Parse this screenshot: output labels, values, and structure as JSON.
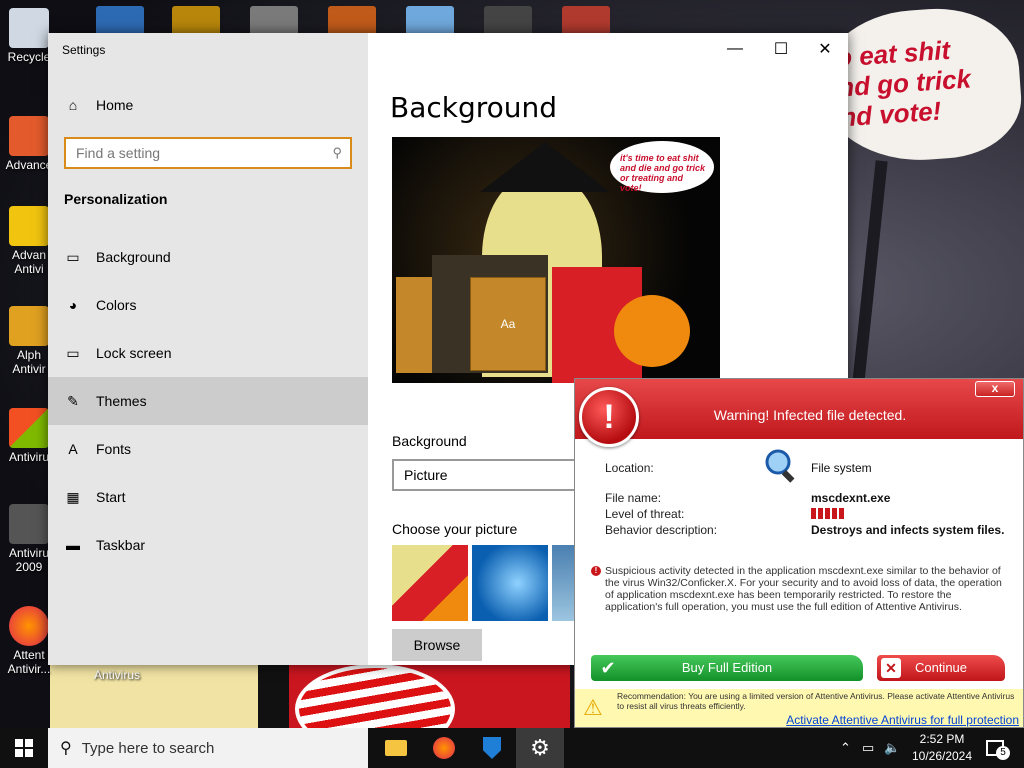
{
  "desktop": {
    "bubble_text": "o eat shit\nnd go trick\nnd vote!",
    "icons": [
      {
        "label": "Recycle"
      },
      {
        "label": "Advance"
      },
      {
        "label": "Advan\nAntivi"
      },
      {
        "label": "Alph\nAntivir"
      },
      {
        "label": "Antiviru"
      },
      {
        "label": "Antiviru\n2009"
      },
      {
        "label": "Attent\nAntivir..."
      },
      {
        "label": "Antivirus"
      }
    ]
  },
  "settings": {
    "window_title": "Settings",
    "home_label": "Home",
    "search_placeholder": "Find a setting",
    "section": "Personalization",
    "nav": [
      {
        "label": "Background",
        "icon": "picture-icon"
      },
      {
        "label": "Colors",
        "icon": "palette-icon"
      },
      {
        "label": "Lock screen",
        "icon": "lock-screen-icon"
      },
      {
        "label": "Themes",
        "icon": "themes-icon"
      },
      {
        "label": "Fonts",
        "icon": "fonts-icon"
      },
      {
        "label": "Start",
        "icon": "start-icon"
      },
      {
        "label": "Taskbar",
        "icon": "taskbar-icon"
      }
    ],
    "selected_nav": "Themes",
    "page_title": "Background",
    "preview_bubble": "it's time to eat shit and die and go trick or treating and vote!",
    "preview_tile": "Aa",
    "background_label": "Background",
    "background_value": "Picture",
    "choose_picture_label": "Choose your picture",
    "browse_label": "Browse"
  },
  "antivirus": {
    "title": "Warning! Infected file detected.",
    "close": "x",
    "location_label": "Location:",
    "location_value": "File system",
    "filename_label": "File name:",
    "filename_value": "mscdexnt.exe",
    "threat_label": "Level of threat:",
    "threat_level": 5,
    "behavior_label": "Behavior description:",
    "behavior_value": "Destroys and infects system files.",
    "message": "Suspicious activity detected in the application mscdexnt.exe similar to the behavior of the virus Win32/Conficker.X. For your security and to avoid loss of data, the operation of application mscdexnt.exe has been temporarily restricted. To restore the application's full operation, you must use the full edition of Attentive Antivirus.",
    "buy_label": "Buy Full Edition",
    "continue_label": "Continue",
    "recommendation": "Recommendation: You are using a limited version of Attentive Antivirus. Please activate Attentive Antivirus to resist all virus threats efficiently.",
    "activate_link": "Activate Attentive Antivirus for full protection"
  },
  "taskbar": {
    "search_placeholder": "Type here to search",
    "time": "2:52 PM",
    "date": "10/26/2024",
    "notifications": "5"
  },
  "colors": {
    "accent": "#d98b1a",
    "warning_red": "#c8161b",
    "buy_green": "#13912a"
  }
}
